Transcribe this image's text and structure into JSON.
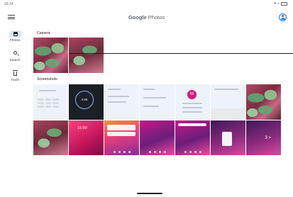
{
  "status_bar": {
    "time": "15:14",
    "icons": [
      "notification-icon",
      "wifi-icon",
      "battery-icon"
    ]
  },
  "app_bar": {
    "logo_google": "Google",
    "logo_photos": "Photos",
    "menu_icon": "menu-icon",
    "account_icon": "account-icon"
  },
  "nav": {
    "items": [
      {
        "label": "Photos",
        "icon": "photos-icon",
        "active": true
      },
      {
        "label": "Search",
        "icon": "search-icon",
        "active": false
      },
      {
        "label": "Trash",
        "icon": "trash-icon",
        "active": false
      }
    ]
  },
  "sections": {
    "camera": {
      "title": "Camera"
    },
    "screenshots": {
      "title": "Screenshots"
    }
  },
  "thumbnails": {
    "clock_time": "4:56",
    "lock_time": "15:00",
    "avatar_letter": "M",
    "big_text": "3 >"
  },
  "colors": {
    "accent": "#1a73e8",
    "active_pill": "#dbe6fb"
  }
}
